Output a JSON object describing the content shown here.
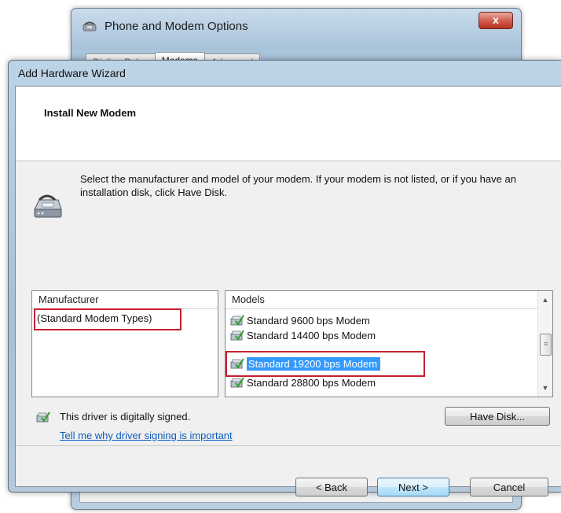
{
  "background_window": {
    "title": "Phone and Modem Options",
    "close_glyph": "x",
    "tabs": [
      "Dialing Rules",
      "Modems",
      "Advanced"
    ],
    "active_tab": "Modems"
  },
  "wizard": {
    "title": "Add Hardware Wizard",
    "header_title": "Install New Modem",
    "description": "Select the manufacturer and model of your modem. If your modem is not listed, or if you have an installation disk, click Have Disk.",
    "manufacturer": {
      "header": "Manufacturer",
      "items": [
        "(Standard Modem Types)"
      ]
    },
    "models": {
      "header": "Models",
      "items": [
        "Standard  9600 bps Modem",
        "Standard 14400 bps Modem",
        "Standard 19200 bps Modem",
        "Standard 28800 bps Modem"
      ],
      "selected_index": 2
    },
    "signed_text": "This driver is digitally signed.",
    "signed_link": "Tell me why driver signing is important",
    "buttons": {
      "have_disk": "Have Disk...",
      "back": "< Back",
      "next": "Next >",
      "cancel": "Cancel"
    }
  },
  "colors": {
    "selection": "#3399ff",
    "highlight_box": "#c8202f",
    "link": "#0b5bbf"
  },
  "icons": [
    "phone-modem-icon",
    "modem-driver-icon",
    "signed-driver-icon",
    "close-icon",
    "scroll-up-icon",
    "scroll-down-icon"
  ]
}
